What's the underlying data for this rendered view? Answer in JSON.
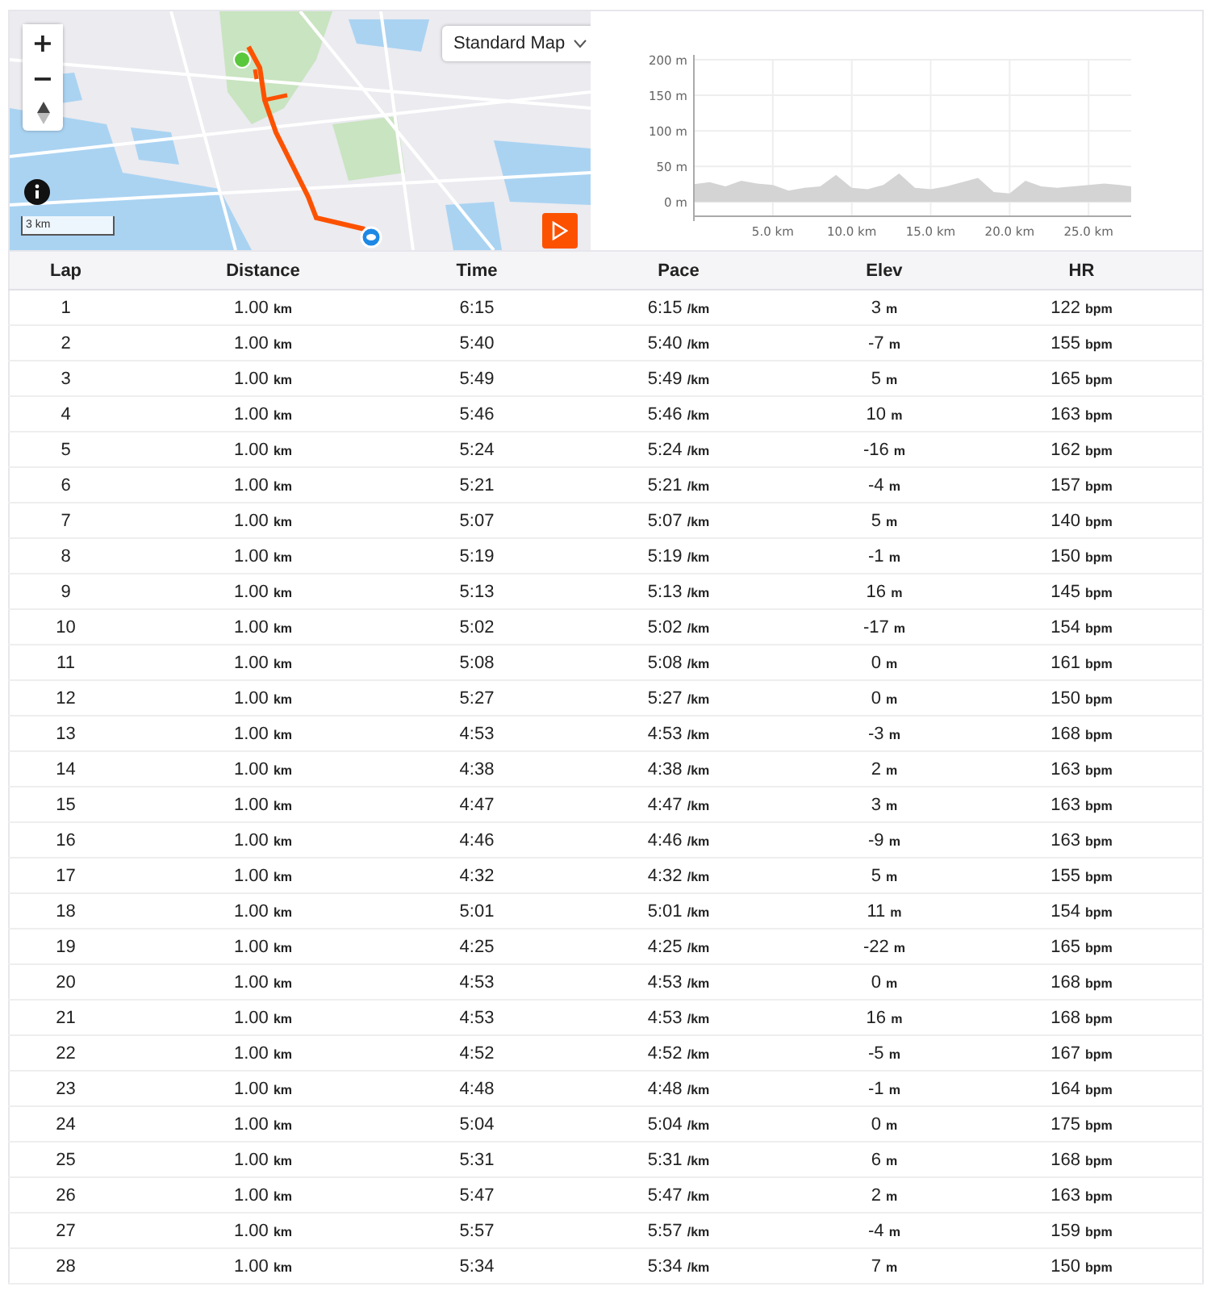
{
  "map": {
    "zoom_in": "+",
    "zoom_out": "−",
    "scale": "3 km",
    "map_type": "Standard Map"
  },
  "elevation_chart": {
    "chart_data": {
      "type": "area",
      "x": [
        0,
        1,
        2,
        3,
        4,
        5,
        6,
        7,
        8,
        9,
        10,
        11,
        12,
        13,
        14,
        15,
        16,
        17,
        18,
        19,
        20,
        21,
        22,
        23,
        24,
        25,
        26,
        27,
        27.7
      ],
      "grid": true,
      "series": [
        {
          "color": "#d4d4d4",
          "values": [
            25,
            28,
            22,
            30,
            26,
            24,
            16,
            20,
            22,
            38,
            20,
            18,
            24,
            40,
            20,
            18,
            22,
            28,
            34,
            14,
            12,
            30,
            22,
            20,
            22,
            24,
            26,
            24,
            22
          ]
        }
      ],
      "xlim": [
        0,
        27.7
      ],
      "ylim": [
        -20,
        200
      ],
      "xticks": [
        {
          "value": 5,
          "label": "5.0 km"
        },
        {
          "value": 10,
          "label": "10.0 km"
        },
        {
          "value": 15,
          "label": "15.0 km"
        },
        {
          "value": 20,
          "label": "20.0 km"
        },
        {
          "value": 25,
          "label": "25.0 km"
        }
      ],
      "yticks": [
        {
          "value": 0,
          "label": "0 m"
        },
        {
          "value": 50,
          "label": "50 m"
        },
        {
          "value": 100,
          "label": "100 m"
        },
        {
          "value": 150,
          "label": "150 m"
        },
        {
          "value": 200,
          "label": "200 m"
        }
      ]
    }
  },
  "laps_table": {
    "columns": [
      "Lap",
      "Distance",
      "Time",
      "Pace",
      "Elev",
      "HR"
    ],
    "rows": [
      [
        {
          "value": "1"
        },
        {
          "value": "1.00",
          "unit": "km"
        },
        {
          "value": "6:15"
        },
        {
          "value": "6:15",
          "unit": "/km"
        },
        {
          "value": "3",
          "unit": "m"
        },
        {
          "value": "122",
          "unit": "bpm"
        }
      ],
      [
        {
          "value": "2"
        },
        {
          "value": "1.00",
          "unit": "km"
        },
        {
          "value": "5:40"
        },
        {
          "value": "5:40",
          "unit": "/km"
        },
        {
          "value": "-7",
          "unit": "m"
        },
        {
          "value": "155",
          "unit": "bpm"
        }
      ],
      [
        {
          "value": "3"
        },
        {
          "value": "1.00",
          "unit": "km"
        },
        {
          "value": "5:49"
        },
        {
          "value": "5:49",
          "unit": "/km"
        },
        {
          "value": "5",
          "unit": "m"
        },
        {
          "value": "165",
          "unit": "bpm"
        }
      ],
      [
        {
          "value": "4"
        },
        {
          "value": "1.00",
          "unit": "km"
        },
        {
          "value": "5:46"
        },
        {
          "value": "5:46",
          "unit": "/km"
        },
        {
          "value": "10",
          "unit": "m"
        },
        {
          "value": "163",
          "unit": "bpm"
        }
      ],
      [
        {
          "value": "5"
        },
        {
          "value": "1.00",
          "unit": "km"
        },
        {
          "value": "5:24"
        },
        {
          "value": "5:24",
          "unit": "/km"
        },
        {
          "value": "-16",
          "unit": "m"
        },
        {
          "value": "162",
          "unit": "bpm"
        }
      ],
      [
        {
          "value": "6"
        },
        {
          "value": "1.00",
          "unit": "km"
        },
        {
          "value": "5:21"
        },
        {
          "value": "5:21",
          "unit": "/km"
        },
        {
          "value": "-4",
          "unit": "m"
        },
        {
          "value": "157",
          "unit": "bpm"
        }
      ],
      [
        {
          "value": "7"
        },
        {
          "value": "1.00",
          "unit": "km"
        },
        {
          "value": "5:07"
        },
        {
          "value": "5:07",
          "unit": "/km"
        },
        {
          "value": "5",
          "unit": "m"
        },
        {
          "value": "140",
          "unit": "bpm"
        }
      ],
      [
        {
          "value": "8"
        },
        {
          "value": "1.00",
          "unit": "km"
        },
        {
          "value": "5:19"
        },
        {
          "value": "5:19",
          "unit": "/km"
        },
        {
          "value": "-1",
          "unit": "m"
        },
        {
          "value": "150",
          "unit": "bpm"
        }
      ],
      [
        {
          "value": "9"
        },
        {
          "value": "1.00",
          "unit": "km"
        },
        {
          "value": "5:13"
        },
        {
          "value": "5:13",
          "unit": "/km"
        },
        {
          "value": "16",
          "unit": "m"
        },
        {
          "value": "145",
          "unit": "bpm"
        }
      ],
      [
        {
          "value": "10"
        },
        {
          "value": "1.00",
          "unit": "km"
        },
        {
          "value": "5:02"
        },
        {
          "value": "5:02",
          "unit": "/km"
        },
        {
          "value": "-17",
          "unit": "m"
        },
        {
          "value": "154",
          "unit": "bpm"
        }
      ],
      [
        {
          "value": "11"
        },
        {
          "value": "1.00",
          "unit": "km"
        },
        {
          "value": "5:08"
        },
        {
          "value": "5:08",
          "unit": "/km"
        },
        {
          "value": "0",
          "unit": "m"
        },
        {
          "value": "161",
          "unit": "bpm"
        }
      ],
      [
        {
          "value": "12"
        },
        {
          "value": "1.00",
          "unit": "km"
        },
        {
          "value": "5:27"
        },
        {
          "value": "5:27",
          "unit": "/km"
        },
        {
          "value": "0",
          "unit": "m"
        },
        {
          "value": "150",
          "unit": "bpm"
        }
      ],
      [
        {
          "value": "13"
        },
        {
          "value": "1.00",
          "unit": "km"
        },
        {
          "value": "4:53"
        },
        {
          "value": "4:53",
          "unit": "/km"
        },
        {
          "value": "-3",
          "unit": "m"
        },
        {
          "value": "168",
          "unit": "bpm"
        }
      ],
      [
        {
          "value": "14"
        },
        {
          "value": "1.00",
          "unit": "km"
        },
        {
          "value": "4:38"
        },
        {
          "value": "4:38",
          "unit": "/km"
        },
        {
          "value": "2",
          "unit": "m"
        },
        {
          "value": "163",
          "unit": "bpm"
        }
      ],
      [
        {
          "value": "15"
        },
        {
          "value": "1.00",
          "unit": "km"
        },
        {
          "value": "4:47"
        },
        {
          "value": "4:47",
          "unit": "/km"
        },
        {
          "value": "3",
          "unit": "m"
        },
        {
          "value": "163",
          "unit": "bpm"
        }
      ],
      [
        {
          "value": "16"
        },
        {
          "value": "1.00",
          "unit": "km"
        },
        {
          "value": "4:46"
        },
        {
          "value": "4:46",
          "unit": "/km"
        },
        {
          "value": "-9",
          "unit": "m"
        },
        {
          "value": "163",
          "unit": "bpm"
        }
      ],
      [
        {
          "value": "17"
        },
        {
          "value": "1.00",
          "unit": "km"
        },
        {
          "value": "4:32"
        },
        {
          "value": "4:32",
          "unit": "/km"
        },
        {
          "value": "5",
          "unit": "m"
        },
        {
          "value": "155",
          "unit": "bpm"
        }
      ],
      [
        {
          "value": "18"
        },
        {
          "value": "1.00",
          "unit": "km"
        },
        {
          "value": "5:01"
        },
        {
          "value": "5:01",
          "unit": "/km"
        },
        {
          "value": "11",
          "unit": "m"
        },
        {
          "value": "154",
          "unit": "bpm"
        }
      ],
      [
        {
          "value": "19"
        },
        {
          "value": "1.00",
          "unit": "km"
        },
        {
          "value": "4:25"
        },
        {
          "value": "4:25",
          "unit": "/km"
        },
        {
          "value": "-22",
          "unit": "m"
        },
        {
          "value": "165",
          "unit": "bpm"
        }
      ],
      [
        {
          "value": "20"
        },
        {
          "value": "1.00",
          "unit": "km"
        },
        {
          "value": "4:53"
        },
        {
          "value": "4:53",
          "unit": "/km"
        },
        {
          "value": "0",
          "unit": "m"
        },
        {
          "value": "168",
          "unit": "bpm"
        }
      ],
      [
        {
          "value": "21"
        },
        {
          "value": "1.00",
          "unit": "km"
        },
        {
          "value": "4:53"
        },
        {
          "value": "4:53",
          "unit": "/km"
        },
        {
          "value": "16",
          "unit": "m"
        },
        {
          "value": "168",
          "unit": "bpm"
        }
      ],
      [
        {
          "value": "22"
        },
        {
          "value": "1.00",
          "unit": "km"
        },
        {
          "value": "4:52"
        },
        {
          "value": "4:52",
          "unit": "/km"
        },
        {
          "value": "-5",
          "unit": "m"
        },
        {
          "value": "167",
          "unit": "bpm"
        }
      ],
      [
        {
          "value": "23"
        },
        {
          "value": "1.00",
          "unit": "km"
        },
        {
          "value": "4:48"
        },
        {
          "value": "4:48",
          "unit": "/km"
        },
        {
          "value": "-1",
          "unit": "m"
        },
        {
          "value": "164",
          "unit": "bpm"
        }
      ],
      [
        {
          "value": "24"
        },
        {
          "value": "1.00",
          "unit": "km"
        },
        {
          "value": "5:04"
        },
        {
          "value": "5:04",
          "unit": "/km"
        },
        {
          "value": "0",
          "unit": "m"
        },
        {
          "value": "175",
          "unit": "bpm"
        }
      ],
      [
        {
          "value": "25"
        },
        {
          "value": "1.00",
          "unit": "km"
        },
        {
          "value": "5:31"
        },
        {
          "value": "5:31",
          "unit": "/km"
        },
        {
          "value": "6",
          "unit": "m"
        },
        {
          "value": "168",
          "unit": "bpm"
        }
      ],
      [
        {
          "value": "26"
        },
        {
          "value": "1.00",
          "unit": "km"
        },
        {
          "value": "5:47"
        },
        {
          "value": "5:47",
          "unit": "/km"
        },
        {
          "value": "2",
          "unit": "m"
        },
        {
          "value": "163",
          "unit": "bpm"
        }
      ],
      [
        {
          "value": "27"
        },
        {
          "value": "1.00",
          "unit": "km"
        },
        {
          "value": "5:57"
        },
        {
          "value": "5:57",
          "unit": "/km"
        },
        {
          "value": "-4",
          "unit": "m"
        },
        {
          "value": "159",
          "unit": "bpm"
        }
      ],
      [
        {
          "value": "28"
        },
        {
          "value": "1.00",
          "unit": "km"
        },
        {
          "value": "5:34"
        },
        {
          "value": "5:34",
          "unit": "/km"
        },
        {
          "value": "7",
          "unit": "m"
        },
        {
          "value": "150",
          "unit": "bpm"
        }
      ]
    ]
  }
}
